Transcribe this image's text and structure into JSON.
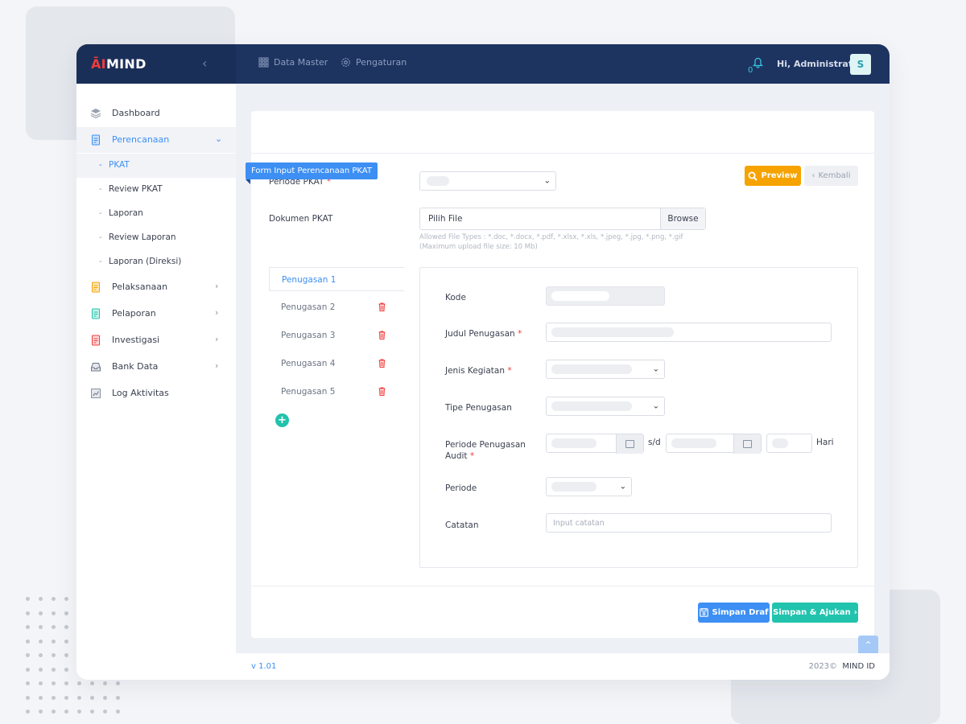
{
  "app": {
    "logo_prefix": "ĀI",
    "logo_suffix": "MIND",
    "version": "v 1.01",
    "copyright": "2023©",
    "brand": "MIND ID"
  },
  "topbar": {
    "nav": [
      {
        "label": "Data Master",
        "icon": "grid-icon"
      },
      {
        "label": "Pengaturan",
        "icon": "gear-icon"
      }
    ],
    "notification_count": "0",
    "greeting": "Hi, Administrator",
    "avatar_initial": "S"
  },
  "sidebar": {
    "items": [
      {
        "label": "Dashboard",
        "icon": "layers-icon"
      },
      {
        "label": "Perencanaan",
        "icon": "document-icon",
        "expanded": true
      },
      {
        "label": "Pelaksanaan",
        "icon": "document-icon"
      },
      {
        "label": "Pelaporan",
        "icon": "document-icon"
      },
      {
        "label": "Investigasi",
        "icon": "document-icon"
      },
      {
        "label": "Bank Data",
        "icon": "inbox-icon"
      },
      {
        "label": "Log Aktivitas",
        "icon": "chart-icon"
      }
    ],
    "sub_items": [
      "PKAT",
      "Review PKAT",
      "Laporan",
      "Review Laporan",
      "Laporan (Direksi)"
    ]
  },
  "form": {
    "ribbon_title": "Form Input Perencanaan PKAT",
    "preview_label": "Preview",
    "back_label": "Kembali",
    "periode_label": "Periode PKAT",
    "required_mark": "*",
    "dokumen_label": "Dokumen PKAT",
    "file_placeholder": "Pilih File",
    "browse_label": "Browse",
    "allowed_types": "Allowed File Types : *.doc, *.docx, *.pdf, *.xlsx, *.xls, *.jpeg, *.jpg, *.png, *.gif",
    "max_size": "(Maximum upload file size: 10 Mb)"
  },
  "tabs": [
    "Penugasan 1",
    "Penugasan 2",
    "Penugasan 3",
    "Penugasan 4",
    "Penugasan 5"
  ],
  "detail": {
    "kode_label": "Kode",
    "judul_label": "Judul Penugasan",
    "jenis_label": "Jenis Kegiatan",
    "tipe_label": "Tipe Penugasan",
    "periode_audit_label_1": "Periode Penugasan",
    "periode_audit_label_2": "Audit",
    "sd": "s/d",
    "hari": "Hari",
    "periode_label": "Periode",
    "catatan_label": "Catatan",
    "catatan_placeholder": "Input catatan"
  },
  "footer_buttons": {
    "draft": "Simpan Draf",
    "submit": "Simpan & Ajukan"
  },
  "colors": {
    "topbar": "#1d3461",
    "primary": "#3d8ff3",
    "warning": "#f6a300",
    "success": "#21c3ad",
    "danger": "#ef3b3b"
  }
}
